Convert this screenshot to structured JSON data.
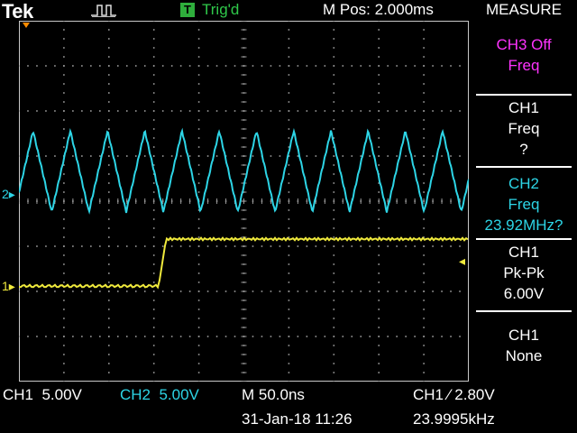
{
  "header": {
    "brand": "Tek",
    "trigger_badge": "T",
    "trigger_status": "Trig'd",
    "mpos": "M Pos: 2.000ms",
    "menu_title": "MEASURE"
  },
  "sidebar": {
    "items": [
      {
        "line1": "CH3 Off",
        "line2": "Freq",
        "line3": ""
      },
      {
        "line1": "CH1",
        "line2": "Freq",
        "line3": "?"
      },
      {
        "line1": "CH2",
        "line2": "Freq",
        "line3": "23.92MHz?"
      },
      {
        "line1": "CH1",
        "line2": "Pk-Pk",
        "line3": "6.00V"
      },
      {
        "line1": "CH1",
        "line2": "None",
        "line3": ""
      }
    ]
  },
  "channels": {
    "ch2_marker": "2",
    "ch1_marker": "1"
  },
  "footer": {
    "ch1_scale": "CH1  5.00V",
    "ch2_scale": "CH2  5.00V",
    "timebase": "M 50.0ns",
    "trigger": "CH1 ⁄ 2.80V",
    "datetime": "31-Jan-18 11:26",
    "frequency": "23.9995kHz"
  },
  "colors": {
    "ch1": "#f0ea3c",
    "ch2": "#2dd5e6",
    "trigger": "#2fae3c",
    "highlight": "#ff33ff"
  },
  "icons": {
    "run_indicator": "pulse-icon",
    "trigger_level": "arrow-left-icon"
  }
}
